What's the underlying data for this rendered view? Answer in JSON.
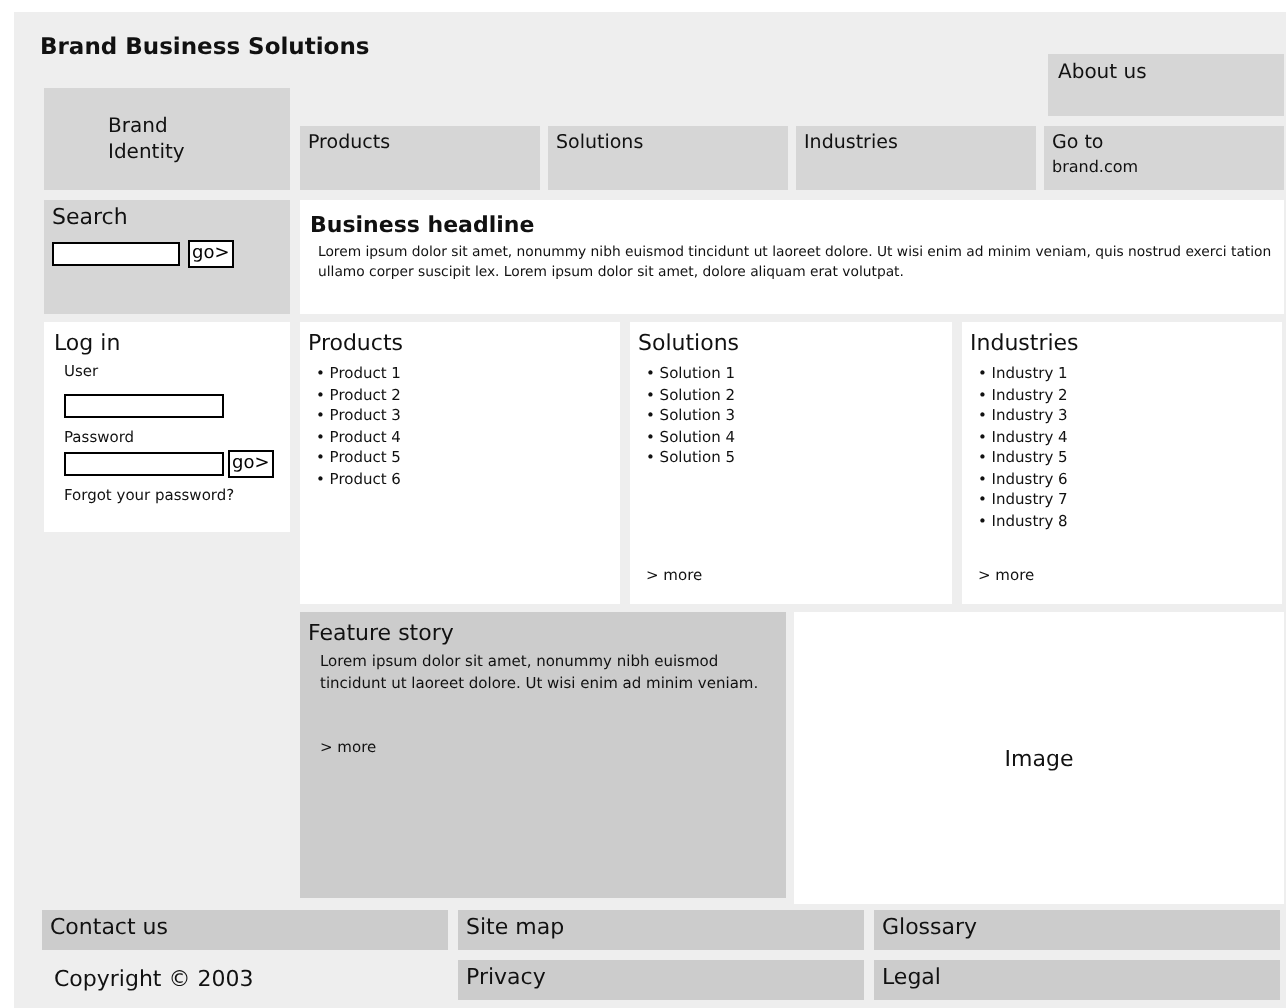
{
  "site_title": "Brand Business Solutions",
  "about": "About us",
  "brand": "Brand Identity",
  "nav": [
    {
      "label": "Products"
    },
    {
      "label": "Solutions"
    },
    {
      "label": "Industries"
    }
  ],
  "goto": {
    "label": "Go to",
    "sub": "brand.com"
  },
  "search": {
    "title": "Search",
    "button": "go>"
  },
  "headline": {
    "title": "Business headline",
    "text": "Lorem ipsum dolor sit amet, nonummy nibh euismod tincidunt ut laoreet dolore. Ut wisi enim ad minim veniam, quis nostrud exerci tation ullamo corper suscipit lex. Lorem ipsum dolor sit amet, dolore aliquam erat volutpat."
  },
  "login": {
    "title": "Log in",
    "user_label": "User",
    "password_label": "Password",
    "button": "go>",
    "forgot": "Forgot your password?"
  },
  "columns": [
    {
      "title": "Products",
      "items": [
        "• Product 1",
        "• Product 2",
        "• Product 3",
        "• Product 4",
        "• Product 5",
        "• Product 6"
      ]
    },
    {
      "title": "Solutions",
      "items": [
        "• Solution 1",
        "• Solution 2",
        "• Solution 3",
        "• Solution 4",
        "• Solution 5"
      ],
      "more": "> more"
    },
    {
      "title": "Industries",
      "items": [
        "• Industry 1",
        "• Industry 2",
        "• Industry 3",
        "• Industry 4",
        "• Industry 5",
        "• Industry 6",
        "• Industry 7",
        "• Industry 8"
      ],
      "more": "> more"
    }
  ],
  "feature": {
    "title": "Feature story",
    "text": "Lorem ipsum dolor sit amet, nonummy nibh euismod tincidunt ut laoreet dolore. Ut wisi enim ad minim veniam.",
    "more": "> more"
  },
  "image_label": "Image",
  "footer": {
    "contact": "Contact us",
    "copyright": "Copyright © 2003",
    "links": [
      "Site map",
      "Glossary",
      "Privacy",
      "Legal"
    ]
  }
}
